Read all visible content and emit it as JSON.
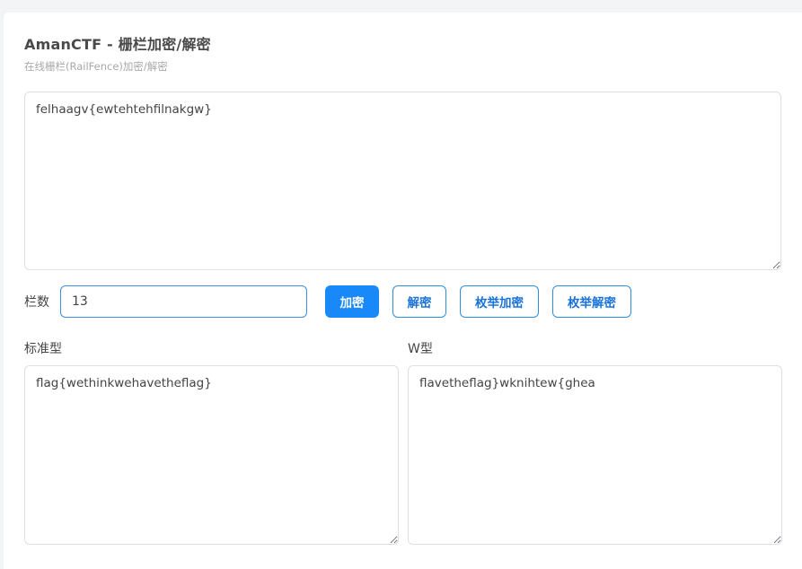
{
  "header": {
    "title": "AmanCTF - 栅栏加密/解密",
    "subtitle": "在线栅栏(RailFence)加密/解密"
  },
  "input": {
    "text": "felhaagv{ewtehtehfilnakgw}"
  },
  "controls": {
    "rails_label": "栏数",
    "rails_value": "13",
    "encrypt_label": "加密",
    "decrypt_label": "解密",
    "enum_encrypt_label": "枚举加密",
    "enum_decrypt_label": "枚举解密"
  },
  "outputs": {
    "standard": {
      "label": "标准型",
      "text": "flag{wethinkwehavetheflag}"
    },
    "w_type": {
      "label": "W型",
      "text": "flavetheflag}wknihtew{ghea"
    }
  },
  "colors": {
    "primary": "#1989fa",
    "outline_text": "#1a73d9",
    "border": "#dcdfe6",
    "page_bg": "#f3f4f6"
  }
}
